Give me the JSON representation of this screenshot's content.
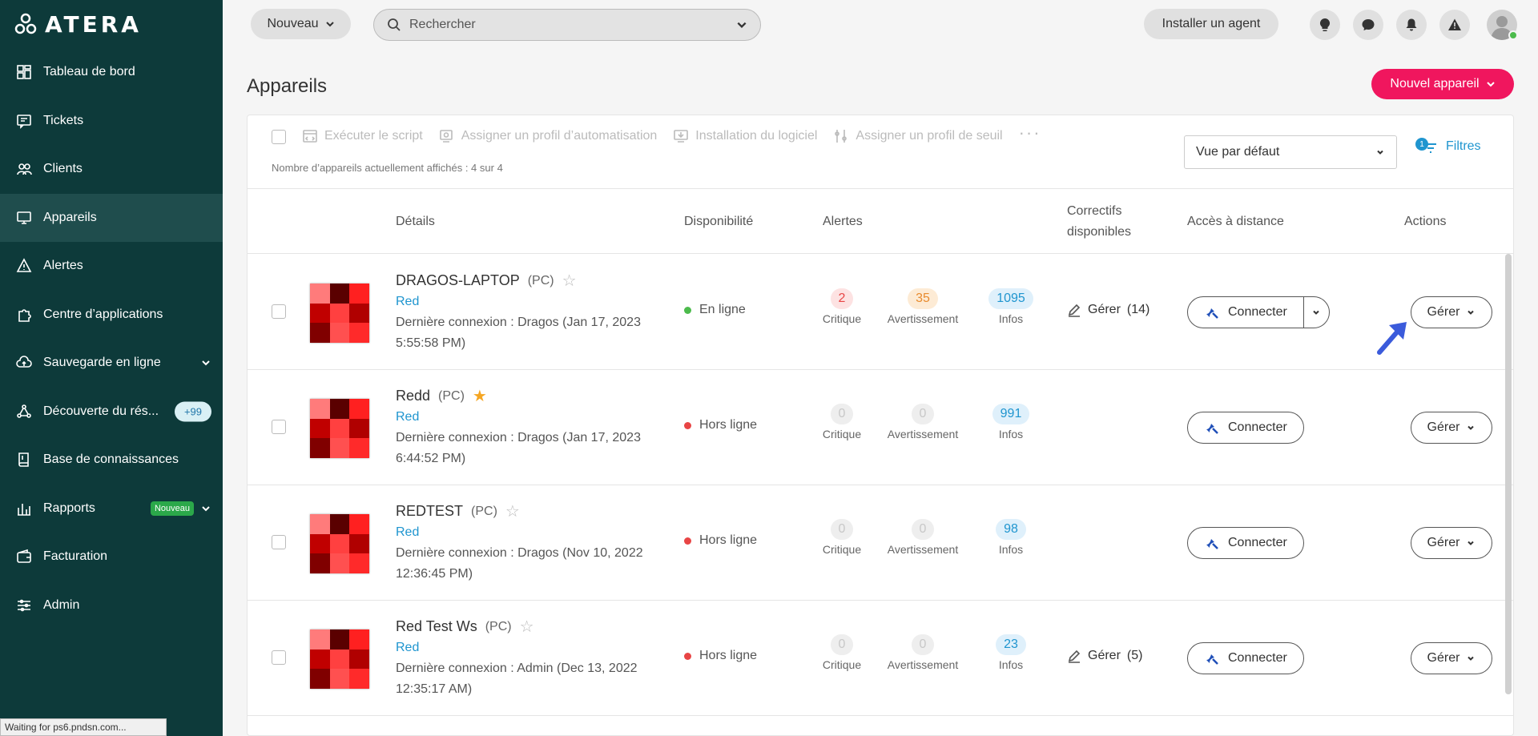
{
  "sidebar": {
    "logo": "ATERA",
    "items": [
      {
        "label": "Tableau de bord",
        "icon": "dashboard-icon"
      },
      {
        "label": "Tickets",
        "icon": "ticket-icon"
      },
      {
        "label": "Clients",
        "icon": "users-icon"
      },
      {
        "label": "Appareils",
        "icon": "monitor-icon",
        "active": true
      },
      {
        "label": "Alertes",
        "icon": "warning-icon"
      },
      {
        "label": "Centre d’applications",
        "icon": "puzzle-icon"
      },
      {
        "label": "Sauvegarde en ligne",
        "icon": "cloud-icon"
      },
      {
        "label": "Découverte du rés...",
        "icon": "network-icon",
        "badge": "+99"
      },
      {
        "label": "Base de connaissances",
        "icon": "book-icon"
      },
      {
        "label": "Rapports",
        "icon": "chart-icon",
        "badge": "Nouveau"
      },
      {
        "label": "Facturation",
        "icon": "wallet-icon"
      },
      {
        "label": "Admin",
        "icon": "sliders-icon"
      }
    ]
  },
  "statusbar": "Waiting for ps6.pndsn.com...",
  "topbar": {
    "new_label": "Nouveau",
    "search_placeholder": "Rechercher",
    "install_agent": "Installer un agent"
  },
  "page": {
    "title": "Appareils",
    "new_device": "Nouvel appareil"
  },
  "toolbar": {
    "actions": [
      "Exécuter le script",
      "Assigner un profil d’automatisation",
      "Installation du logiciel",
      "Assigner un profil de seuil"
    ],
    "count_text": "Nombre d’appareils actuellement affichés : 4 sur 4",
    "view": "Vue par défaut",
    "filters": "Filtres",
    "filters_count": "1"
  },
  "table": {
    "headers": {
      "details": "Détails",
      "availability": "Disponibilité",
      "alerts": "Alertes",
      "patches_1": "Correctifs",
      "patches_2": "disponibles",
      "remote": "Accès à distance",
      "actions": "Actions"
    },
    "alert_labels": {
      "critical": "Critique",
      "warning": "Avertissement",
      "info": "Infos"
    },
    "connect_label": "Connecter",
    "manage_label": "Gérer",
    "rows": [
      {
        "name": "DRAGOS-LAPTOP",
        "type": "(PC)",
        "starred": false,
        "client": "Red",
        "last_conn_1": "Dernière connexion : Dragos (Jan 17, 2023",
        "last_conn_2": "5:55:58 PM)",
        "status": "En ligne",
        "online": true,
        "critical": "2",
        "warning": "35",
        "info": "1095",
        "patch": "Gérer",
        "patch_count": "(14)",
        "split": true
      },
      {
        "name": "Redd",
        "type": "(PC)",
        "starred": true,
        "client": "Red",
        "last_conn_1": "Dernière connexion : Dragos (Jan 17, 2023",
        "last_conn_2": "6:44:52 PM)",
        "status": "Hors ligne",
        "online": false,
        "critical": "0",
        "warning": "0",
        "info": "991",
        "patch": "",
        "patch_count": "",
        "split": false
      },
      {
        "name": "REDTEST",
        "type": "(PC)",
        "starred": false,
        "client": "Red",
        "last_conn_1": "Dernière connexion : Dragos (Nov 10, 2022",
        "last_conn_2": "12:36:45 PM)",
        "status": "Hors ligne",
        "online": false,
        "critical": "0",
        "warning": "0",
        "info": "98",
        "patch": "",
        "patch_count": "",
        "split": false
      },
      {
        "name": "Red Test Ws",
        "type": "(PC)",
        "starred": false,
        "client": "Red",
        "last_conn_1": "Dernière connexion : Admin (Dec 13, 2022",
        "last_conn_2": "12:35:17 AM)",
        "status": "Hors ligne",
        "online": false,
        "critical": "0",
        "warning": "0",
        "info": "23",
        "patch": "Gérer",
        "patch_count": "(5)",
        "split": false
      }
    ]
  },
  "colors": {
    "sidebar_bg": "#0d3a3a",
    "accent": "#f0165e",
    "link": "#1f95cf",
    "online": "#4cbb4c",
    "offline": "#e84545"
  }
}
